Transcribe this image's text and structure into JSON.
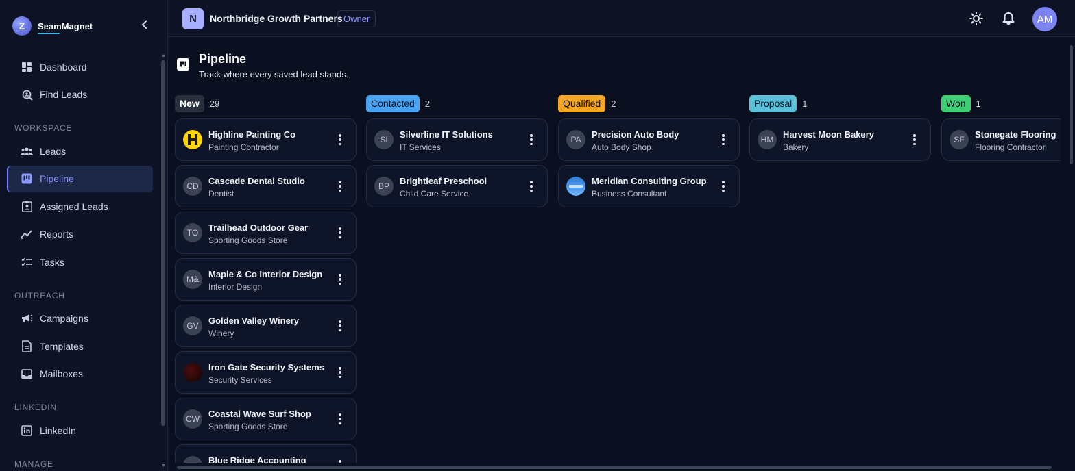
{
  "brand": {
    "name": "SeamMagnet",
    "logo_letter": "Z"
  },
  "nav": {
    "top": [
      {
        "label": "Dashboard",
        "icon": "dashboard-icon"
      },
      {
        "label": "Find Leads",
        "icon": "search-leads-icon"
      }
    ],
    "sections": [
      {
        "label": "WORKSPACE",
        "items": [
          {
            "label": "Leads",
            "icon": "users-icon"
          },
          {
            "label": "Pipeline",
            "icon": "kanban-icon",
            "active": true
          },
          {
            "label": "Assigned Leads",
            "icon": "badge-icon"
          },
          {
            "label": "Reports",
            "icon": "chart-icon"
          },
          {
            "label": "Tasks",
            "icon": "tasks-icon"
          }
        ]
      },
      {
        "label": "OUTREACH",
        "items": [
          {
            "label": "Campaigns",
            "icon": "megaphone-icon"
          },
          {
            "label": "Templates",
            "icon": "document-icon"
          },
          {
            "label": "Mailboxes",
            "icon": "inbox-icon"
          }
        ]
      },
      {
        "label": "LINKEDIN",
        "items": [
          {
            "label": "LinkedIn",
            "icon": "linkedin-icon"
          }
        ]
      },
      {
        "label": "MANAGE",
        "items": []
      }
    ]
  },
  "topbar": {
    "org_initial": "N",
    "org_name": "Northbridge Growth Partners",
    "role": "Owner",
    "user_initials": "AM"
  },
  "page": {
    "title": "Pipeline",
    "subtitle": "Track where every saved lead stands."
  },
  "colors": {
    "new": "#2a2f3d",
    "contacted": "#4aa3f0",
    "qualified": "#f5a623",
    "proposal": "#5bc0d8",
    "won": "#3ecf74",
    "accent": "#8d9bff"
  },
  "columns": [
    {
      "stage": "New",
      "count": "29",
      "color": "#2a2f3d",
      "text_color": "#ffffff",
      "cards": [
        {
          "initials": "",
          "name": "Highline Painting Co",
          "category": "Painting Contractor",
          "logo": "yellow"
        },
        {
          "initials": "CD",
          "name": "Cascade Dental Studio",
          "category": "Dentist"
        },
        {
          "initials": "TO",
          "name": "Trailhead Outdoor Gear",
          "category": "Sporting Goods Store"
        },
        {
          "initials": "M&",
          "name": "Maple & Co Interior Design",
          "category": "Interior Design"
        },
        {
          "initials": "GV",
          "name": "Golden Valley Winery",
          "category": "Winery"
        },
        {
          "initials": "",
          "name": "Iron Gate Security Systems",
          "category": "Security Services",
          "logo": "dark"
        },
        {
          "initials": "CW",
          "name": "Coastal Wave Surf Shop",
          "category": "Sporting Goods Store"
        },
        {
          "initials": "",
          "name": "Blue Ridge Accounting",
          "category": ""
        }
      ]
    },
    {
      "stage": "Contacted",
      "count": "2",
      "color": "#4aa3f0",
      "text_color": "#0b1020",
      "cards": [
        {
          "initials": "SI",
          "name": "Silverline IT Solutions",
          "category": "IT Services"
        },
        {
          "initials": "BP",
          "name": "Brightleaf Preschool",
          "category": "Child Care Service"
        }
      ]
    },
    {
      "stage": "Qualified",
      "count": "2",
      "color": "#f5a623",
      "text_color": "#0b1020",
      "cards": [
        {
          "initials": "PA",
          "name": "Precision Auto Body",
          "category": "Auto Body Shop"
        },
        {
          "initials": "",
          "name": "Meridian Consulting Group",
          "category": "Business Consultant",
          "logo": "blue"
        }
      ]
    },
    {
      "stage": "Proposal",
      "count": "1",
      "color": "#5bc0d8",
      "text_color": "#0b1020",
      "cards": [
        {
          "initials": "HM",
          "name": "Harvest Moon Bakery",
          "category": "Bakery"
        }
      ]
    },
    {
      "stage": "Won",
      "count": "1",
      "color": "#3ecf74",
      "text_color": "#0b1020",
      "cards": [
        {
          "initials": "SF",
          "name": "Stonegate Flooring",
          "category": "Flooring Contractor"
        }
      ]
    }
  ]
}
